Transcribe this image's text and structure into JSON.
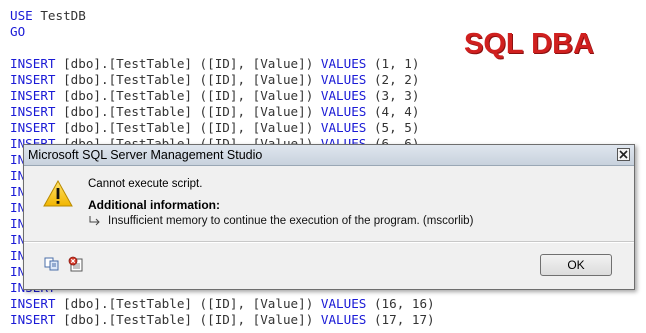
{
  "editor": {
    "lines": [
      {
        "kw": "USE",
        "rest": " TestDB"
      },
      {
        "kw": "GO",
        "rest": ""
      },
      {
        "kw": "",
        "rest": ""
      },
      {
        "kw": "INSERT",
        "rest": " [dbo].[TestTable] ([ID], [Value]) ",
        "kw2": "VALUES",
        "vals": "(1, 1)"
      },
      {
        "kw": "INSERT",
        "rest": " [dbo].[TestTable] ([ID], [Value]) ",
        "kw2": "VALUES",
        "vals": "(2, 2)"
      },
      {
        "kw": "INSERT",
        "rest": " [dbo].[TestTable] ([ID], [Value]) ",
        "kw2": "VALUES",
        "vals": "(3, 3)"
      },
      {
        "kw": "INSERT",
        "rest": " [dbo].[TestTable] ([ID], [Value]) ",
        "kw2": "VALUES",
        "vals": "(4, 4)"
      },
      {
        "kw": "INSERT",
        "rest": " [dbo].[TestTable] ([ID], [Value]) ",
        "kw2": "VALUES",
        "vals": "(5, 5)"
      },
      {
        "kw": "INSERT",
        "rest": " [dbo].[TestTable] ([ID], [Value]) ",
        "kw2": "VALUES",
        "vals": "(6, 6)"
      },
      {
        "kw": "INSERT",
        "rest": "",
        "kw2": "",
        "vals": ""
      },
      {
        "kw": "INSERT",
        "rest": "",
        "kw2": "",
        "vals": ""
      },
      {
        "kw": "INSERT",
        "rest": "",
        "kw2": "",
        "vals": ""
      },
      {
        "kw": "INSERT",
        "rest": "",
        "kw2": "",
        "vals": ""
      },
      {
        "kw": "INSERT",
        "rest": "",
        "kw2": "",
        "vals": ""
      },
      {
        "kw": "INSERT",
        "rest": "",
        "kw2": "",
        "vals": ""
      },
      {
        "kw": "INSERT",
        "rest": "",
        "kw2": "",
        "vals": ""
      },
      {
        "kw": "INSERT",
        "rest": "",
        "kw2": "",
        "vals": ""
      },
      {
        "kw": "INSERT",
        "rest": "",
        "kw2": "",
        "vals": ""
      },
      {
        "kw": "INSERT",
        "rest": " [dbo].[TestTable] ([ID], [Value]) ",
        "kw2": "VALUES",
        "vals": "(16, 16)"
      },
      {
        "kw": "INSERT",
        "rest": " [dbo].[TestTable] ([ID], [Value]) ",
        "kw2": "VALUES",
        "vals": "(17, 17)"
      }
    ]
  },
  "logo": {
    "text": "SQL DBA",
    "color": "#d0201f"
  },
  "dialog": {
    "title": "Microsoft SQL Server Management Studio",
    "message": "Cannot execute script.",
    "additional_title": "Additional information:",
    "detail": "Insufficient memory to continue the execution of the program. (mscorlib)",
    "ok_label": "OK",
    "icons": {
      "warning": "warning-icon",
      "arrow": "arrow-right-icon",
      "copy": "copy-icon",
      "report": "report-icon",
      "close": "close-icon"
    }
  }
}
